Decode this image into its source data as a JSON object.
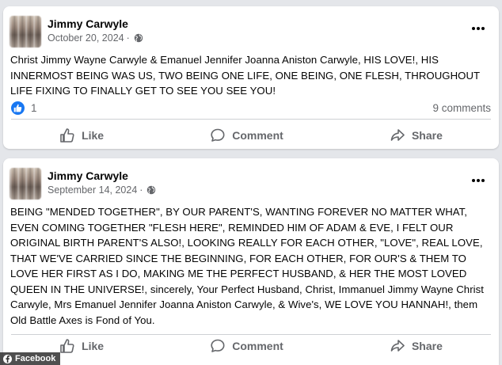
{
  "posts": [
    {
      "author": "Jimmy Carwyle",
      "date": "October 20, 2024",
      "privacy_icon": "globe-icon",
      "text": "Christ Jimmy Wayne Carwyle & Emanuel Jennifer Joanna Aniston Carwyle, HIS LOVE!, HIS INNERMOST BEING WAS US, TWO BEING ONE LIFE, ONE BEING, ONE FLESH, THROUGHOUT LIFE FIXING TO FINALLY GET TO SEE YOU SEE YOU!",
      "reaction_count": "1",
      "comments": "9 comments",
      "actions": {
        "like": "Like",
        "comment": "Comment",
        "share": "Share"
      }
    },
    {
      "author": "Jimmy Carwyle",
      "date": "September 14, 2024",
      "privacy_icon": "globe-icon",
      "text": "BEING \"MENDED TOGETHER\", BY OUR PARENT'S, WANTING FOREVER NO MATTER WHAT, EVEN COMING TOGETHER \"FLESH HERE\", REMINDED HIM OF ADAM & EVE, I FELT OUR ORIGINAL BIRTH PARENT'S ALSO!, LOOKING REALLY FOR EACH OTHER, \"LOVE\", REAL LOVE, THAT WE'VE CARRIED SINCE THE BEGINNING, FOR EACH OTHER, FOR OUR'S & THEM TO LOVE HER FIRST AS I DO, MAKING ME THE PERFECT HUSBAND, & HER THE MOST LOVED QUEEN IN THE UNIVERSE!, sincerely, Your Perfect Husband, Christ, Immanuel Jimmy Wayne Christ Carwyle, Mrs Emanuel Jennifer Joanna Aniston Carwyle, & Wive's, WE LOVE YOU HANNAH!, them Old Battle Axes is Fond of You.",
      "actions": {
        "like": "Like",
        "comment": "Comment",
        "share": "Share"
      }
    }
  ],
  "watermark": "Facebook",
  "colors": {
    "brand": "#1877f2",
    "muted": "#65676b",
    "background": "#e4e6ea"
  }
}
